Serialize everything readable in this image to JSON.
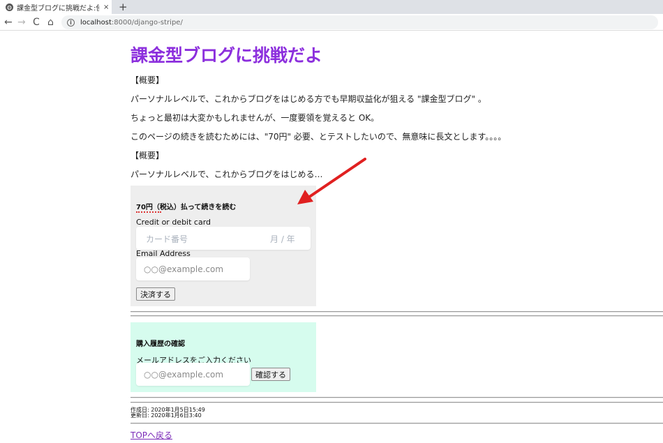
{
  "browser": {
    "tab_title": "課金型ブログに挑戦だよ:使",
    "tab_close": "×",
    "new_tab": "+",
    "nav_back": "←",
    "nav_forward": "→",
    "nav_reload": "C",
    "nav_home": "⌂",
    "url_host": "localhost",
    "url_path": ":8000/django-stripe/"
  },
  "page": {
    "title": "課金型ブログに挑戦だよ",
    "paragraphs": [
      "【概要】",
      "パーソナルレベルで、これからブログをはじめる方でも早期収益化が狙える \"課金型ブログ\" 。",
      "ちょっと最初は大変かもしれませんが、一度要領を覚えると OK。",
      "このページの続きを読むためには、\"70円\" 必要、とテストしたいので、無意味に長文とします。。。。",
      "【概要】",
      "パーソナルレベルで、これからブログをはじめる…"
    ]
  },
  "payment": {
    "heading": "70円（税込）払って続きを読む",
    "card_label": "Credit or debit card",
    "card_number_placeholder": "カード番号",
    "card_expiry_placeholder": "月 / 年",
    "email_label": "Email Address",
    "email_placeholder": "○○@example.com",
    "submit_label": "決済する"
  },
  "history": {
    "heading": "購入履歴の確認",
    "email_prompt": "メールアドレスをご入力ください",
    "email_placeholder": "○○@example.com",
    "confirm_label": "確認する"
  },
  "meta": {
    "created": "作成日: 2020年1月5日15:49",
    "updated": "更新日: 2020年1月6日3:40"
  },
  "footer": {
    "top_link": "TOPへ戻る"
  },
  "colors": {
    "title": "#8c2fdd",
    "payment_bg": "#eeeeee",
    "history_bg": "#d6fcee",
    "annotation_arrow": "#e02020",
    "link": "#7b2bb8"
  },
  "icons": {
    "tab_favicon": "globe-icon",
    "address_info": "info-icon",
    "annotation": "red-arrow-icon"
  }
}
